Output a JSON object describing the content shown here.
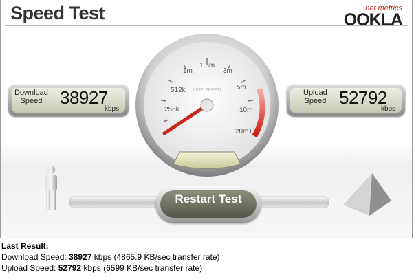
{
  "app": {
    "title": "Speed Test",
    "logo_tagline": "net metrics",
    "logo_name": "OOKLA"
  },
  "download": {
    "label_line1": "Download",
    "label_line2": "Speed",
    "value": "38927",
    "unit": "kbps"
  },
  "upload": {
    "label_line1": "Upload",
    "label_line2": "Speed",
    "value": "52792",
    "unit": "kbps"
  },
  "gauge": {
    "center_label": "LINE SPEED",
    "ticks": [
      "256k",
      "512k",
      "1m",
      "1.5m",
      "3m",
      "5m",
      "10m",
      "20m+"
    ],
    "needle_value": "256k"
  },
  "restart_button": {
    "label": "Restart Test"
  },
  "last_result": {
    "heading": "Last Result:",
    "download_label": "Download Speed: ",
    "download_value": "38927",
    "download_rest": " kbps (4865.9 KB/sec transfer rate)",
    "upload_label": "Upload Speed: ",
    "upload_value": "52792",
    "upload_rest": " kbps (6599 KB/sec transfer rate)"
  },
  "colors": {
    "accent_red": "#d02a1e",
    "panel_face": "#e4e5d3",
    "button_face": "#6d705f"
  }
}
